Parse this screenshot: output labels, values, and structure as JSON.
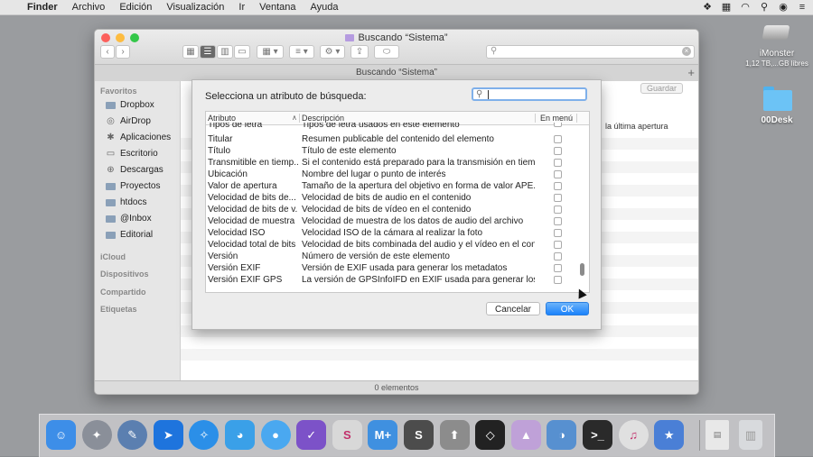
{
  "menubar": {
    "apple": "",
    "app": "Finder",
    "items": [
      "Archivo",
      "Edición",
      "Visualización",
      "Ir",
      "Ventana",
      "Ayuda"
    ]
  },
  "desktop": {
    "disk_name": "iMonster",
    "disk_info": "1,12 TB,...GB libres",
    "folder_name": "00Desk"
  },
  "finder": {
    "title": "Buscando “Sistema”",
    "tab_title": "Buscando “Sistema”",
    "save_label": "Guardar",
    "status": "0 elementos",
    "column_last_open": "la última apertura",
    "sidebar": {
      "favorites_label": "Favoritos",
      "favorites": [
        "Dropbox",
        "AirDrop",
        "Aplicaciones",
        "Escritorio",
        "Descargas",
        "Proyectos",
        "htdocs",
        "@Inbox",
        "Editorial"
      ],
      "icloud_label": "iCloud",
      "devices_label": "Dispositivos",
      "shared_label": "Compartido",
      "tags_label": "Etiquetas"
    }
  },
  "dialog": {
    "prompt": "Selecciona un atributo de búsqueda:",
    "search_value": "",
    "col_attr": "Atributo",
    "col_desc": "Descripción",
    "col_menu": "En menú",
    "rows": [
      {
        "attr": "Tipos de letra",
        "desc": "Tipos de letra usados en este elemento"
      },
      {
        "attr": "Titular",
        "desc": "Resumen publicable del contenido del elemento"
      },
      {
        "attr": "Título",
        "desc": "Título de este elemento"
      },
      {
        "attr": "Transmitible en tiemp...",
        "desc": "Si el contenido está preparado para la transmisión en tiem..."
      },
      {
        "attr": "Ubicación",
        "desc": "Nombre del lugar o punto de interés"
      },
      {
        "attr": "Valor de apertura",
        "desc": "Tamaño de la apertura del objetivo en forma de valor APE..."
      },
      {
        "attr": "Velocidad de bits de...",
        "desc": "Velocidad de bits de audio en el contenido"
      },
      {
        "attr": "Velocidad de bits de v...",
        "desc": "Velocidad de bits de vídeo en el contenido"
      },
      {
        "attr": "Velocidad de muestra",
        "desc": "Velocidad de muestra de los datos de audio del archivo"
      },
      {
        "attr": "Velocidad ISO",
        "desc": "Velocidad ISO de la cámara al realizar la foto"
      },
      {
        "attr": "Velocidad total de bits",
        "desc": "Velocidad de bits combinada del audio y el vídeo en el con..."
      },
      {
        "attr": "Versión",
        "desc": "Número de versión de este elemento"
      },
      {
        "attr": "Versión EXIF",
        "desc": "Versión de EXIF usada para generar los metadatos"
      },
      {
        "attr": "Versión EXIF GPS",
        "desc": "La versión de GPSInfoIFD en EXIF usada para generar los..."
      }
    ],
    "cancel_label": "Cancelar",
    "ok_label": "OK"
  },
  "dock": {
    "apps": [
      {
        "name": "finder-icon",
        "color": "#3d8ee8"
      },
      {
        "name": "launchpad-icon",
        "color": "#8a8f99"
      },
      {
        "name": "preview-icon",
        "color": "#5b7fb0"
      },
      {
        "name": "spark-icon",
        "color": "#1e74dd"
      },
      {
        "name": "safari-icon",
        "color": "#2b8fe8"
      },
      {
        "name": "tweetbot-icon",
        "color": "#3aa0e8"
      },
      {
        "name": "messages-icon",
        "color": "#4aa8f0"
      },
      {
        "name": "omnifocus-icon",
        "color": "#7c52c8"
      },
      {
        "name": "scrivener-icon",
        "color": "#d8d8d8"
      },
      {
        "name": "mplus-icon",
        "color": "#3f90e0"
      },
      {
        "name": "sublime-icon",
        "color": "#4c4c4c"
      },
      {
        "name": "transmit-icon",
        "color": "#8c8c8c"
      },
      {
        "name": "screenflow-icon",
        "color": "#222222"
      },
      {
        "name": "affinity-icon",
        "color": "#bfa1d8"
      },
      {
        "name": "sequel-icon",
        "color": "#5790d0"
      },
      {
        "name": "terminal-icon",
        "color": "#2a2a2a"
      },
      {
        "name": "itunes-icon",
        "color": "#e0e0e0"
      },
      {
        "name": "imovie-icon",
        "color": "#4a7fd6"
      }
    ],
    "docs_color": "#e8e8e8",
    "trash_color": "#d8dadd"
  },
  "colors": {
    "close": "#fc605c",
    "minimize": "#fdbc40",
    "zoom": "#34c749",
    "accent": "#1a82fb"
  }
}
